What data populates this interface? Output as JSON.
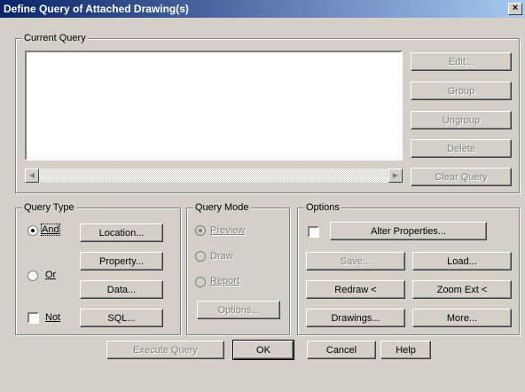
{
  "window": {
    "title": "Define Query of Attached Drawing(s)",
    "close_glyph": "×"
  },
  "current_query": {
    "label": "Current Query",
    "buttons": {
      "edit": "Edit...",
      "group": "Group",
      "ungroup": "Ungroup",
      "delete": "Delete",
      "clear_query": "Clear Query"
    },
    "scroll_left": "◀",
    "scroll_right": "▶"
  },
  "query_type": {
    "label": "Query Type",
    "and_label": "And",
    "or_label": "Or",
    "not_label": "Not",
    "selected": "And",
    "buttons": {
      "location": "Location...",
      "property": "Property...",
      "data": "Data...",
      "sql": "SQL..."
    }
  },
  "query_mode": {
    "label": "Query Mode",
    "preview_label": "Preview",
    "draw_label": "Draw",
    "report_label": "Report",
    "selected": "Preview",
    "options_button": "Options..."
  },
  "options": {
    "label": "Options",
    "buttons": {
      "alter_properties": "Alter Properties...",
      "save": "Save...",
      "load": "Load...",
      "redraw": "Redraw <",
      "zoom_ext": "Zoom Ext <",
      "drawings": "Drawings...",
      "more": "More..."
    }
  },
  "footer": {
    "execute_query": "Execute Query",
    "ok": "OK",
    "cancel": "Cancel",
    "help": "Help"
  },
  "colors": {
    "face": "#d4d0c8",
    "title_start": "#0a246a",
    "title_end": "#a6caf0"
  }
}
